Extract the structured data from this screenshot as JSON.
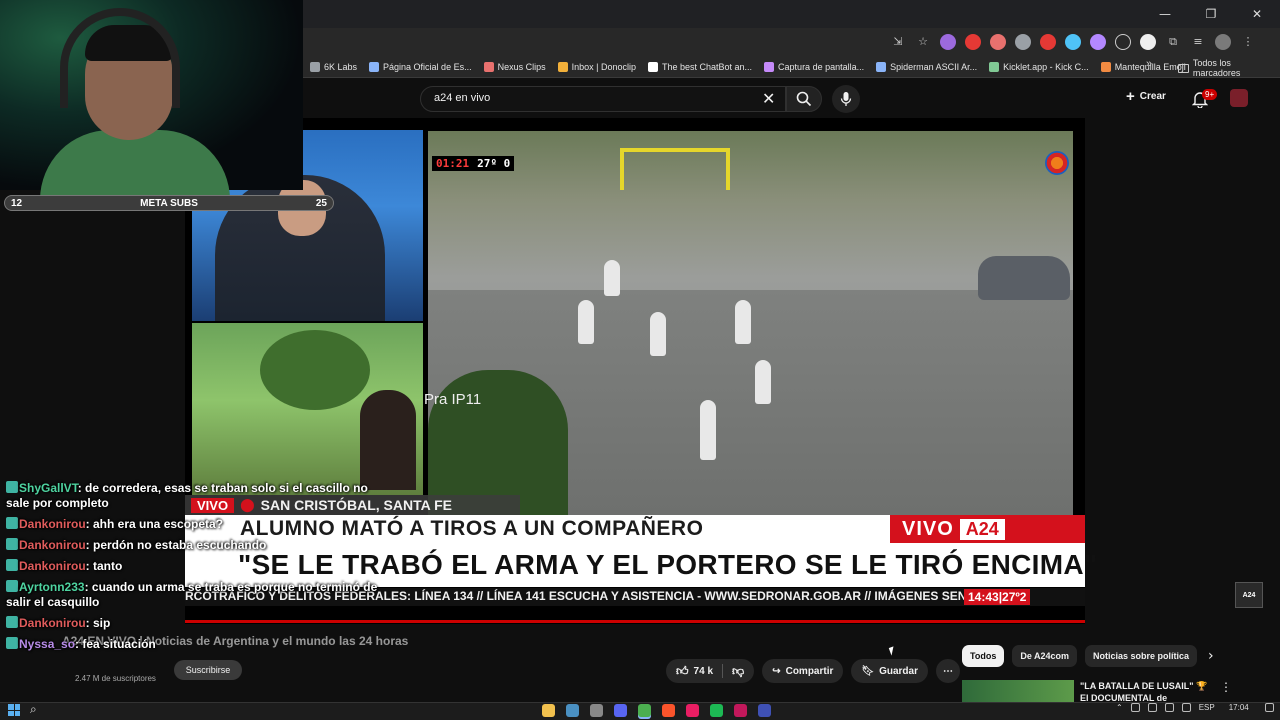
{
  "window": {
    "minimize": "—",
    "restore": "❐",
    "close": "✕"
  },
  "bookmarks": [
    {
      "label": "6K Labs",
      "color": "#9aa0a6"
    },
    {
      "label": "Página Oficial de Es...",
      "color": "#8ab4f8"
    },
    {
      "label": "Nexus Clips",
      "color": "#e8716e"
    },
    {
      "label": "Inbox | Donoclip",
      "color": "#f2b03a"
    },
    {
      "label": "The best ChatBot an...",
      "color": "#ffffff"
    },
    {
      "label": "Captura de pantalla...",
      "color": "#c58af9"
    },
    {
      "label": "Spiderman ASCII Ar...",
      "color": "#8ab4f8"
    },
    {
      "label": "Kicklet.app - Kick C...",
      "color": "#81c995"
    },
    {
      "label": "Mantequilla Emoji",
      "color": "#f28b42"
    }
  ],
  "bookmarks_more": "»",
  "bookmarks_folder": "Todos los marcadores",
  "search": {
    "query": "a24 en vivo",
    "clear_icon": "✕"
  },
  "header": {
    "create_label": "Crear",
    "notifications_badge": "9+"
  },
  "video": {
    "cctv_time": "01:21",
    "cctv_temp": "27º 0",
    "camera_label": "Pra IP11",
    "location_live": "VIVO",
    "location_text": "SAN CRISTÓBAL, SANTA FE",
    "headline_1": "ALUMNO MATÓ A TIROS A UN COMPAÑERO",
    "live_tag": "VIVO",
    "channel_tag": "A24",
    "headline_2": "\"SE LE TRABÓ EL ARMA Y EL PORTERO SE LE TIRÓ ENCIMA\"",
    "ticker": "RCOTRÁFICO Y DELITOS FEDERALES: LÍNEA 134 // LÍNEA 141 ESCUCHA Y ASISTENCIA - WWW.SEDRONAR.GOB.AR // IMÁGENES SENSIBLES.",
    "ticker_time": "14:43|27º2",
    "small_logo": "A24"
  },
  "meta_bar": {
    "left": "12",
    "label": "META SUBS",
    "right": "25"
  },
  "chat": [
    {
      "user": "ShyGallVT",
      "color": "green",
      "text": " de corredera, esas se traban solo si el cascillo no sale por completo"
    },
    {
      "user": "Dankonirou",
      "color": "red",
      "text": " ahh era una escopeta?"
    },
    {
      "user": "Dankonirou",
      "color": "red",
      "text": " perdón no estaba escuchando"
    },
    {
      "user": "Dankonirou",
      "color": "red",
      "text": " tanto"
    },
    {
      "user": "Ayrtonn233",
      "color": "green",
      "text": " cuando un arma se traba es porque no terminó de salir el casquillo"
    },
    {
      "user": "Dankonirou",
      "color": "red",
      "text": " sip"
    },
    {
      "user": "Nyssa_so",
      "color": "purple",
      "text": " fea situación"
    }
  ],
  "below": {
    "title": "A24 EN VIVO | Noticias de Argentina y el mundo las 24 horas",
    "subs": "2.47 M de suscriptores",
    "subscribe": "Suscribirse",
    "likes": "74 k",
    "share": "Compartir",
    "save": "Guardar",
    "more": "⋯"
  },
  "chips": [
    "Todos",
    "De A24com",
    "Noticias sobre política"
  ],
  "chips_next": "›",
  "recommendation": {
    "title": "\"LA BATALLA DE LUSAIL\" 🏆 El DOCUMENTAL de ARGENTINA",
    "more": "⋮"
  },
  "taskbar": {
    "lang": "ESP",
    "time": "17:04"
  }
}
